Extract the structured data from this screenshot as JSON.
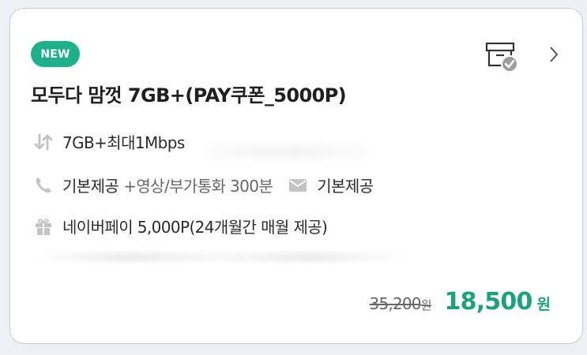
{
  "card": {
    "badge": "NEW",
    "title": "모두다 맘껏 7GB+(PAY쿠폰_5000P)",
    "data_row": {
      "icon": "updown-arrows-icon",
      "text": "7GB+최대1Mbps"
    },
    "call_row": {
      "icon": "phone-icon",
      "main": "기본제공",
      "sub": "+영상/부가통화 300분",
      "sms_icon": "envelope-icon",
      "sms": "기본제공"
    },
    "benefit_row": {
      "icon": "gift-icon",
      "text": "네이버페이 5,000P(24개월간 매월 제공)"
    },
    "price": {
      "original": "35,200",
      "original_unit": "원",
      "sale": "18,500",
      "sale_unit": "원"
    }
  },
  "colors": {
    "accent": "#1db08a",
    "price": "#1aa27f",
    "icon": "#c4c4c4"
  }
}
